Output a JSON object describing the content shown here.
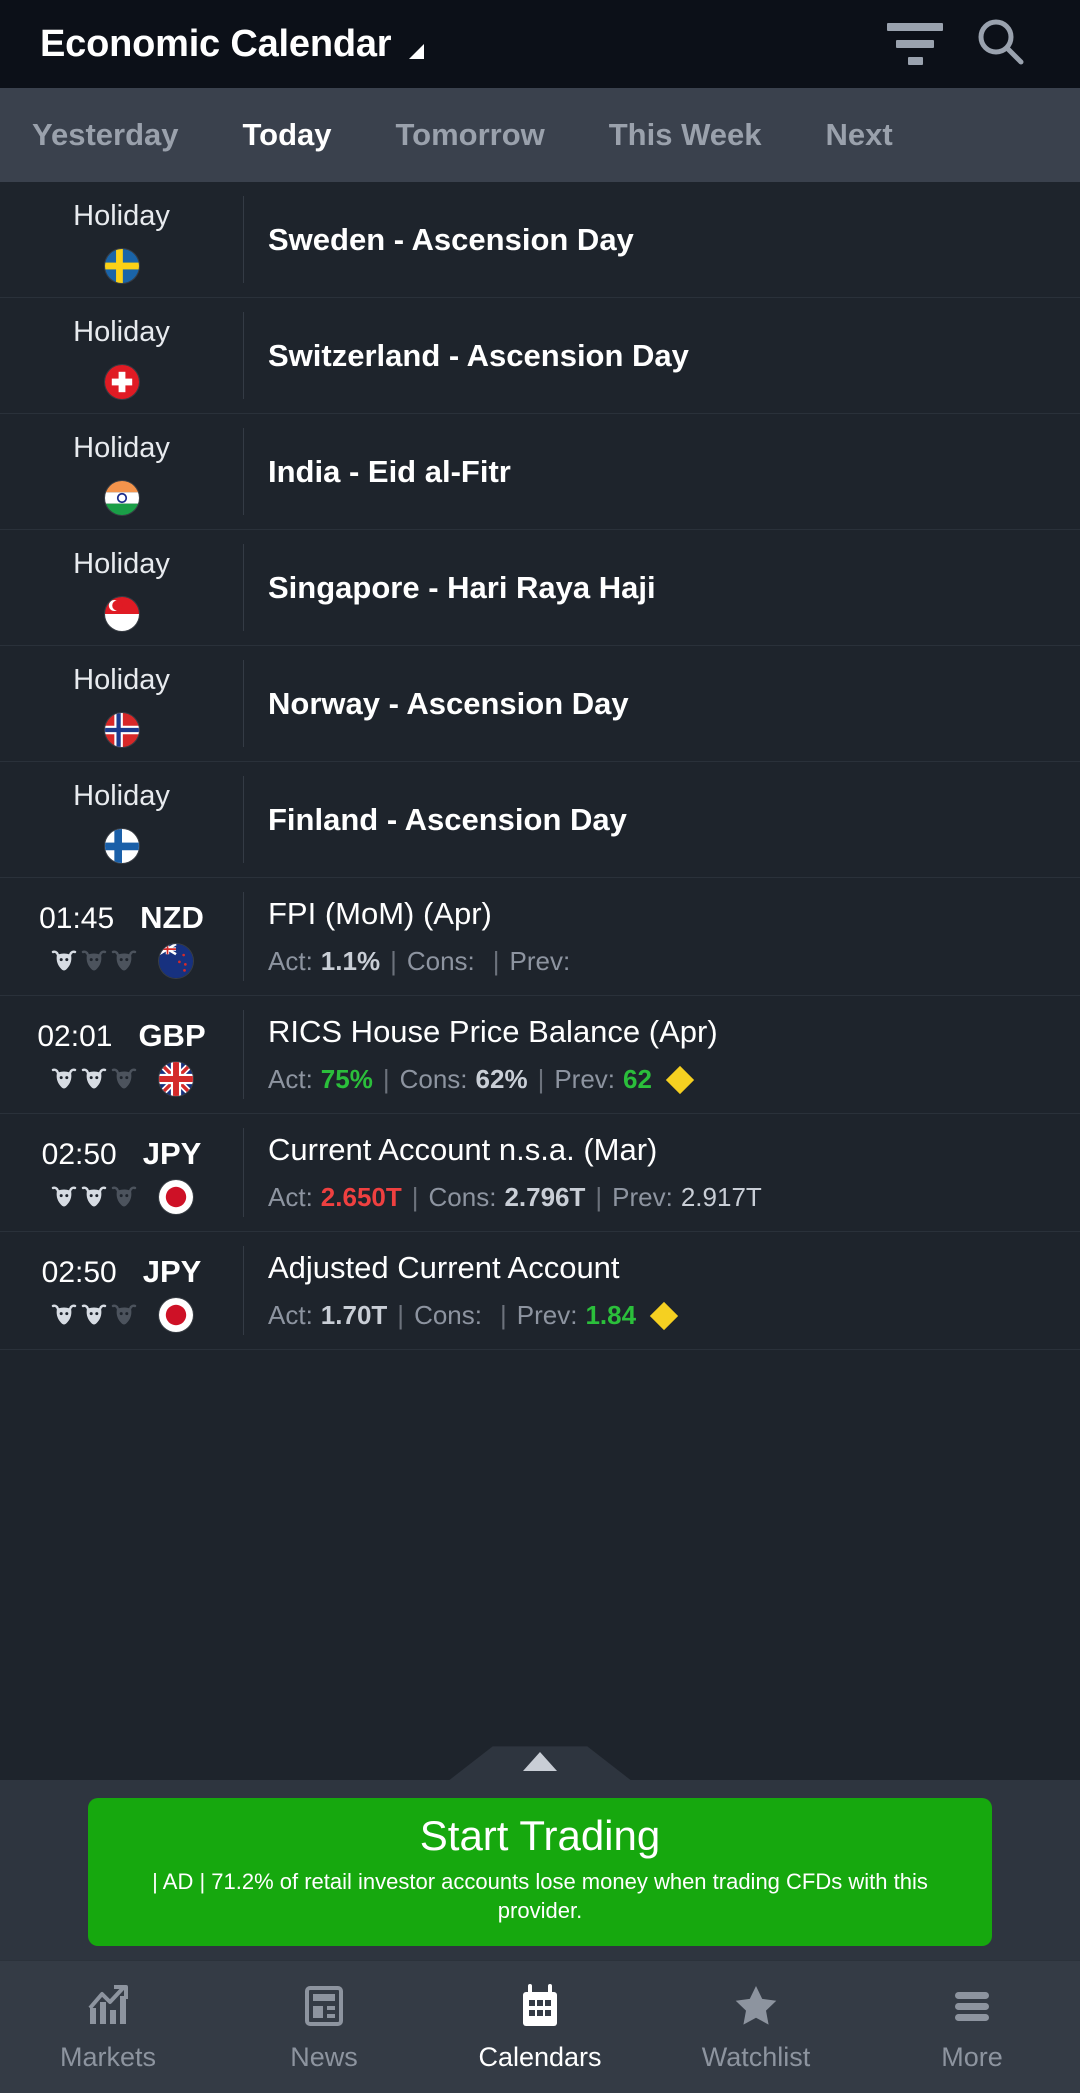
{
  "header": {
    "title": "Economic Calendar",
    "caret_icon": "triangle-down-icon",
    "filter_icon": "filter-icon",
    "search_icon": "search-icon"
  },
  "tabs": [
    {
      "label": "Yesterday",
      "active": false
    },
    {
      "label": "Today",
      "active": true
    },
    {
      "label": "Tomorrow",
      "active": false
    },
    {
      "label": "This Week",
      "active": false
    },
    {
      "label": "Next",
      "active": false
    }
  ],
  "colors": {
    "accent_green": "#2BBF3B",
    "accent_red": "#EF4040",
    "diamond_yellow": "#F5D021",
    "ad_green": "#16A80E",
    "header_bg": "#0C1018",
    "tabs_bg": "#3A414D",
    "row_bg": "#1E242C",
    "nav_bg": "#343B45"
  },
  "rows": [
    {
      "kind": "holiday",
      "time_label": "Holiday",
      "flag": "sweden-flag-icon",
      "name": "Sweden - Ascension Day"
    },
    {
      "kind": "holiday",
      "time_label": "Holiday",
      "flag": "switzerland-flag-icon",
      "name": "Switzerland - Ascension Day"
    },
    {
      "kind": "holiday",
      "time_label": "Holiday",
      "flag": "india-flag-icon",
      "name": "India - Eid al-Fitr"
    },
    {
      "kind": "holiday",
      "time_label": "Holiday",
      "flag": "singapore-flag-icon",
      "name": "Singapore - Hari Raya Haji"
    },
    {
      "kind": "holiday",
      "time_label": "Holiday",
      "flag": "norway-flag-icon",
      "name": "Norway - Ascension Day"
    },
    {
      "kind": "holiday",
      "time_label": "Holiday",
      "flag": "finland-flag-icon",
      "name": "Finland - Ascension Day"
    },
    {
      "kind": "event",
      "time": "01:45",
      "currency": "NZD",
      "flag": "newzealand-flag-icon",
      "volatility": 1,
      "name": "FPI (MoM) (Apr)",
      "act_label": "Act:",
      "act_value": "1.1%",
      "act_state": "neutral",
      "cons_label": "Cons:",
      "cons_value": "",
      "cons_state": "plain",
      "prev_label": "Prev:",
      "prev_value": "",
      "prev_state": "plain",
      "diamond": false
    },
    {
      "kind": "event",
      "time": "02:01",
      "currency": "GBP",
      "flag": "uk-flag-icon",
      "volatility": 2,
      "name": "RICS House Price Balance (Apr)",
      "act_label": "Act:",
      "act_value": "75%",
      "act_state": "up",
      "cons_label": "Cons:",
      "cons_value": "62%",
      "cons_state": "neutral",
      "prev_label": "Prev:",
      "prev_value": "62",
      "prev_state": "up",
      "diamond": true
    },
    {
      "kind": "event",
      "time": "02:50",
      "currency": "JPY",
      "flag": "japan-flag-icon",
      "volatility": 2,
      "name": "Current Account n.s.a. (Mar)",
      "act_label": "Act:",
      "act_value": "2.650T",
      "act_state": "down",
      "cons_label": "Cons:",
      "cons_value": "2.796T",
      "cons_state": "neutral",
      "prev_label": "Prev:",
      "prev_value": "2.917T",
      "prev_state": "plain",
      "diamond": false
    },
    {
      "kind": "event",
      "time": "02:50",
      "currency": "JPY",
      "flag": "japan-flag-icon",
      "volatility": 2,
      "name": "Adjusted Current Account",
      "act_label": "Act:",
      "act_value": "1.70T",
      "act_state": "neutral",
      "cons_label": "Cons:",
      "cons_value": "",
      "cons_state": "plain",
      "prev_label": "Prev:",
      "prev_value": "1.84",
      "prev_state": "up",
      "diamond": true
    }
  ],
  "ad": {
    "title": "Start Trading",
    "disclaimer": "| AD | 71.2% of retail investor accounts lose money when trading CFDs with this provider."
  },
  "collapse_handle": {
    "icon": "chevron-up-icon"
  },
  "bottom_nav": [
    {
      "label": "Markets",
      "icon": "chart-up-icon",
      "active": false
    },
    {
      "label": "News",
      "icon": "news-icon",
      "active": false
    },
    {
      "label": "Calendars",
      "icon": "calendar-icon",
      "active": true
    },
    {
      "label": "Watchlist",
      "icon": "star-icon",
      "active": false
    },
    {
      "label": "More",
      "icon": "hamburger-icon",
      "active": false
    }
  ]
}
